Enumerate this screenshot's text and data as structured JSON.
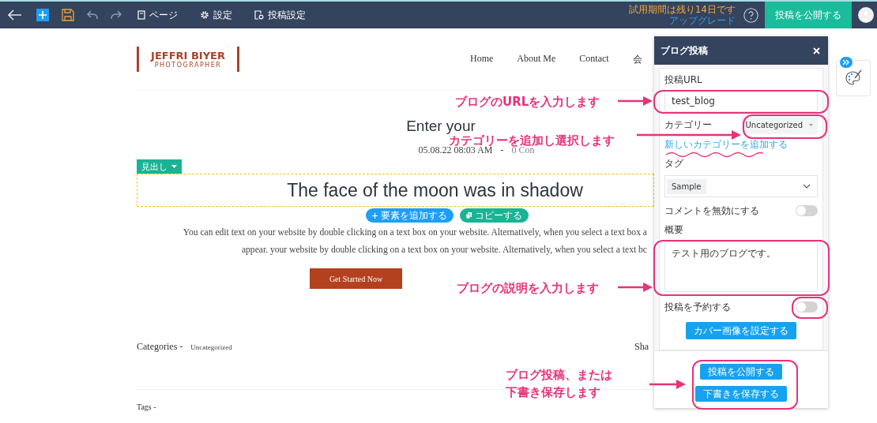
{
  "toolbar": {
    "menu": [
      {
        "kind": "page",
        "label": "ページ"
      },
      {
        "kind": "settings",
        "label": "設定"
      },
      {
        "kind": "post",
        "label": "投稿設定"
      }
    ],
    "trial": "試用期間は残り14日です",
    "upgrade": "アップグレード",
    "publish": "投稿を公開する"
  },
  "site": {
    "logo_title": "JEFFRI BIYER",
    "logo_subtitle": "PHOTOGRAPHER",
    "nav": [
      "Home",
      "About Me",
      "Contact",
      "会"
    ],
    "post_title": "Enter your",
    "date": "05.08.22 08:03 AM",
    "separator": "-",
    "comments": "0 Con",
    "element_tag": "見出し",
    "heading": "The face of the moon was in shadow",
    "add_element": "要素を追加する",
    "copy": "コピーする",
    "paragraph": [
      "You can edit text on your website by double clicking on a text box on your website. Alternatively, when you select a text box a",
      "appear. your website by double clicking on a text box on your website. Alternatively, when you select a text bc"
    ],
    "cta": "Get Started Now",
    "categories_label": "Categories -",
    "categories_value": "Uncategorized",
    "share": "Sha",
    "tags_label": "Tags -"
  },
  "panel": {
    "title": "ブログ投稿",
    "url_label": "投稿URL",
    "url_value": "test_blog",
    "category_label": "カテゴリー",
    "category_value": "Uncategorized",
    "add_category": "新しいカテゴリーを追加する",
    "tag_label": "タグ",
    "tag_value": "Sample",
    "comments_toggle": {
      "label": "コメントを無効にする",
      "on": false
    },
    "summary_label": "概要",
    "summary_value": "テスト用のブログです。",
    "schedule_toggle": {
      "label": "投稿を予約する",
      "on": false
    },
    "cover_button": "カバー画像を設定する",
    "publish_button": "投稿を公開する",
    "draft_button": "下書きを保存する"
  },
  "annotations": [
    {
      "lines": [
        "ブログのURLを入力します"
      ]
    },
    {
      "lines": [
        "カテゴリーを追加し選択します"
      ]
    },
    {
      "lines": [
        "ブログの説明を入力します"
      ]
    },
    {
      "lines": [
        "ブログ投稿、または",
        "下書き保存します"
      ]
    }
  ]
}
